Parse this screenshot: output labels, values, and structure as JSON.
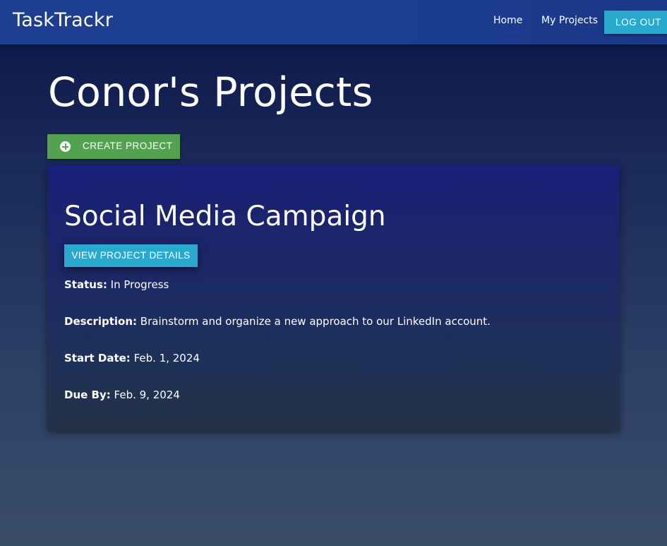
{
  "navbar": {
    "brand": "TaskTrackr",
    "links": {
      "home": "Home",
      "my_projects": "My Projects"
    },
    "logout_label": "LOG OUT"
  },
  "page": {
    "title": "Conor's Projects",
    "create_button": {
      "label": "CREATE PROJECT",
      "icon": "plus-circle-icon"
    }
  },
  "projects": [
    {
      "title": "Social Media Campaign",
      "details_button": "VIEW PROJECT DETAILS",
      "status_label": "Status:",
      "status_value": "In Progress",
      "description_label": "Description:",
      "description_value": "Brainstorm and organize a new approach to our LinkedIn account.",
      "start_label": "Start Date:",
      "start_value": "Feb. 1, 2024",
      "due_label": "Due By:",
      "due_value": "Feb. 9, 2024"
    }
  ],
  "colors": {
    "navbar": "#1e3e92",
    "accent_button": "#2aa9cf",
    "create_button": "#52a24f"
  }
}
